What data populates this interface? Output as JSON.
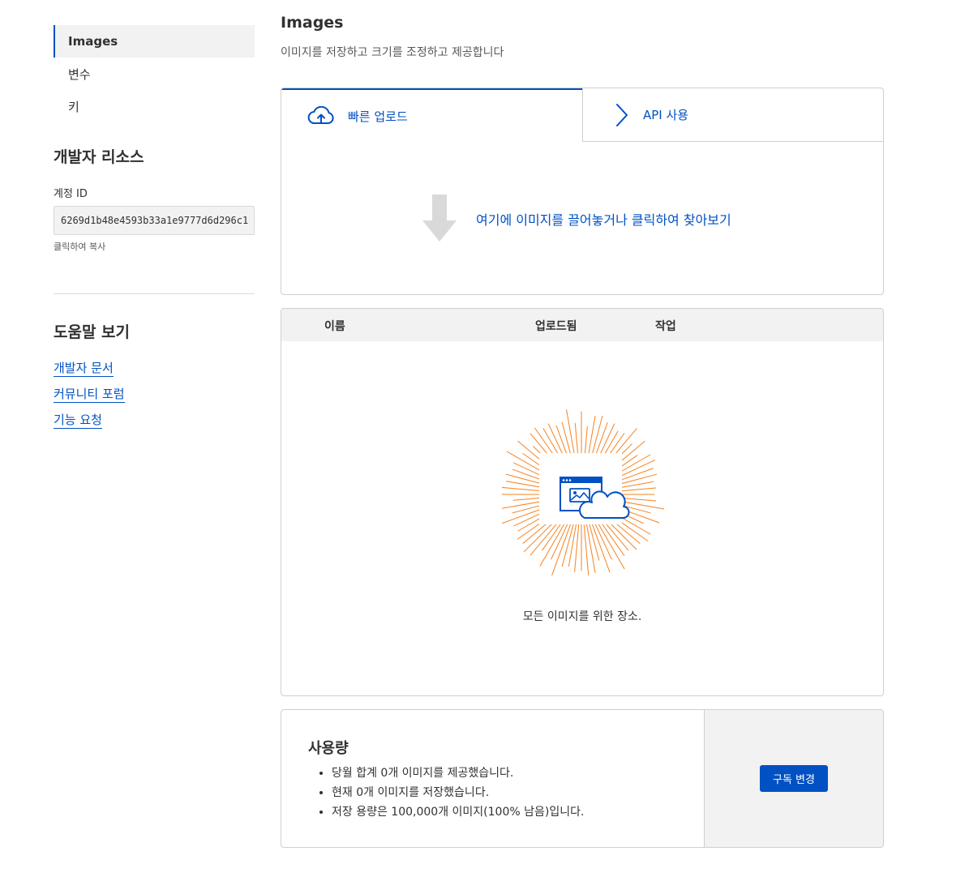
{
  "sidebar": {
    "nav": [
      {
        "label": "Images",
        "active": true
      },
      {
        "label": "변수",
        "active": false
      },
      {
        "label": "키",
        "active": false
      }
    ],
    "resources_title": "개발자 리소스",
    "account_id_label": "계정 ID",
    "account_id_value": "6269d1b48e4593b33a1e9777d6d296c1",
    "copy_hint": "클릭하여 복사",
    "help_title": "도움말 보기",
    "help_links": [
      "개발자 문서",
      "커뮤니티 포럼",
      "기능 요청"
    ]
  },
  "main": {
    "title": "Images",
    "subtitle": "이미지를 저장하고 크기를 조정하고 제공합니다"
  },
  "upload": {
    "tabs": [
      {
        "label": "빠른 업로드",
        "icon": "cloud-upload-icon",
        "active": true
      },
      {
        "label": "API 사용",
        "icon": "chevron-right-icon",
        "active": false
      }
    ],
    "drop_text": "여기에 이미지를 끌어놓거나 클릭하여 찾아보기"
  },
  "table": {
    "columns": [
      "이름",
      "업로드됨",
      "작업"
    ],
    "empty_text": "모든 이미지를 위한 장소."
  },
  "usage": {
    "title": "사용량",
    "items": [
      "당월 합계 0개 이미지를 제공했습니다.",
      "현재 0개 이미지를 저장했습니다.",
      "저장 용량은 100,000개 이미지(100% 남음)입니다."
    ],
    "button_label": "구독 변경"
  },
  "colors": {
    "accent": "#0051c3",
    "burst": "#f6821f",
    "panel": "#f2f2f2"
  }
}
